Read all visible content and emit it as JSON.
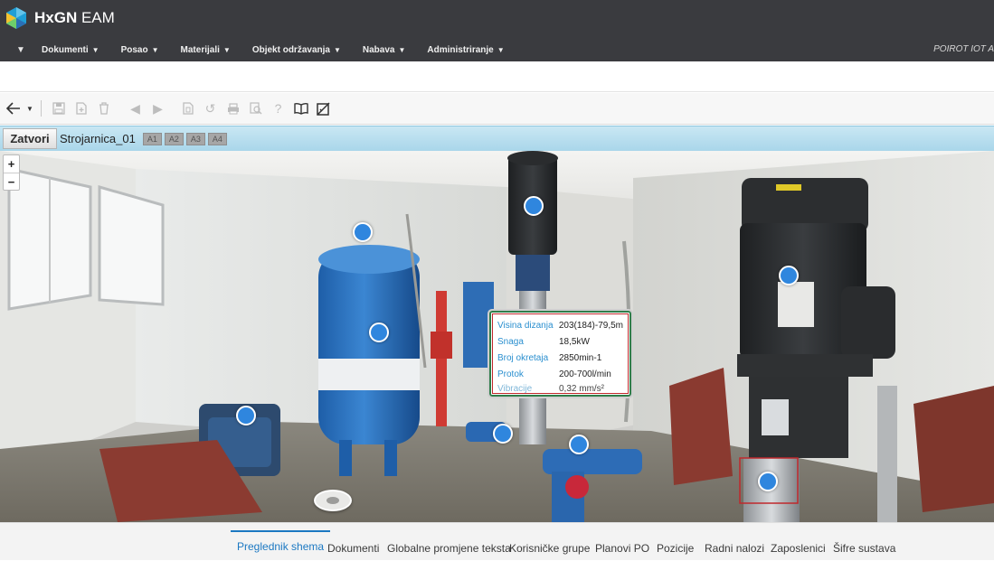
{
  "app": {
    "name_bold": "HxGN",
    "name_regular": " EAM",
    "user": "POIROT IOT A"
  },
  "menu": {
    "items": [
      {
        "label": "Dokumenti"
      },
      {
        "label": "Posao"
      },
      {
        "label": "Materijali"
      },
      {
        "label": "Objekt održavanja"
      },
      {
        "label": "Nabava"
      },
      {
        "label": "Administriranje"
      }
    ]
  },
  "toolbar": {
    "icons": [
      "back-arrow-icon",
      "dropdown-icon",
      "save-icon",
      "new-record-icon",
      "delete-icon",
      "previous-icon",
      "next-icon",
      "copy-icon",
      "refresh-icon",
      "print-icon",
      "preview-icon",
      "help-icon",
      "book-icon",
      "disable-icon"
    ]
  },
  "record": {
    "close_label": "Zatvori",
    "name": "Strojarnica_01",
    "chips": [
      "A1",
      "A2",
      "A3",
      "A4"
    ]
  },
  "viewer": {
    "zoom_in": "+",
    "zoom_out": "−",
    "popup": [
      {
        "key": "Visina dizanja",
        "value": "203(184)-79,5m"
      },
      {
        "key": "Snaga",
        "value": "18,5kW"
      },
      {
        "key": "Broj okretaja",
        "value": "2850min-1"
      },
      {
        "key": "Protok",
        "value": "200-700l/min"
      },
      {
        "key": "Vibracije",
        "value": "0,32 mm/s²"
      }
    ]
  },
  "bottom_tabs": [
    {
      "label": "Preglednik shema",
      "active": true
    },
    {
      "label": "Dokumenti"
    },
    {
      "label": "Globalne promjene teksta"
    },
    {
      "label": "Korisničke grupe"
    },
    {
      "label": "Planovi PO"
    },
    {
      "label": "Pozicije"
    },
    {
      "label": "Radni nalozi"
    },
    {
      "label": "Zaposlenici"
    },
    {
      "label": "Šifre sustava"
    }
  ],
  "colors": {
    "header_bg": "#3a3b3f",
    "hotspot": "#2f86de",
    "accent": "#1b78c2",
    "label_blue": "#2a8fcf",
    "highlight_red": "#c0282c"
  }
}
